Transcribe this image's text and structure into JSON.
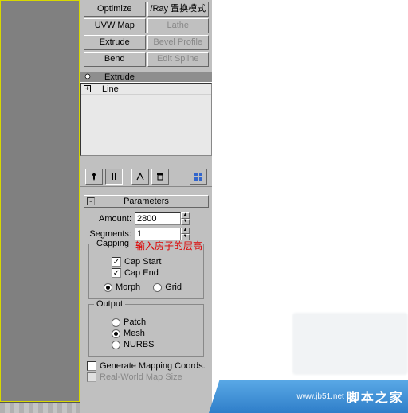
{
  "buttons": {
    "optimize": "Optimize",
    "vray": "/Ray 置换模式",
    "uvwmap": "UVW Map",
    "lathe": "Lathe",
    "extrude": "Extrude",
    "bevel": "Bevel Profile",
    "bend": "Bend",
    "editspline": "Edit Spline"
  },
  "stack": {
    "active": "Extrude",
    "base": "Line"
  },
  "rollout": {
    "parameters": "Parameters"
  },
  "amount": {
    "label": "Amount:",
    "value": "2800"
  },
  "segments": {
    "label": "Segments:",
    "value": "1"
  },
  "capping": {
    "legend": "Capping",
    "annotation": "输入房子的层高",
    "start": "Cap Start",
    "end": "Cap End",
    "morph": "Morph",
    "grid": "Grid"
  },
  "output": {
    "legend": "Output",
    "patch": "Patch",
    "mesh": "Mesh",
    "nurbs": "NURBS"
  },
  "opts": {
    "gen": "Generate Mapping Coords.",
    "realworld": "Real-World Map Size"
  },
  "watermark": {
    "ch": "脚本之家",
    "en": "www.jb51.net"
  }
}
